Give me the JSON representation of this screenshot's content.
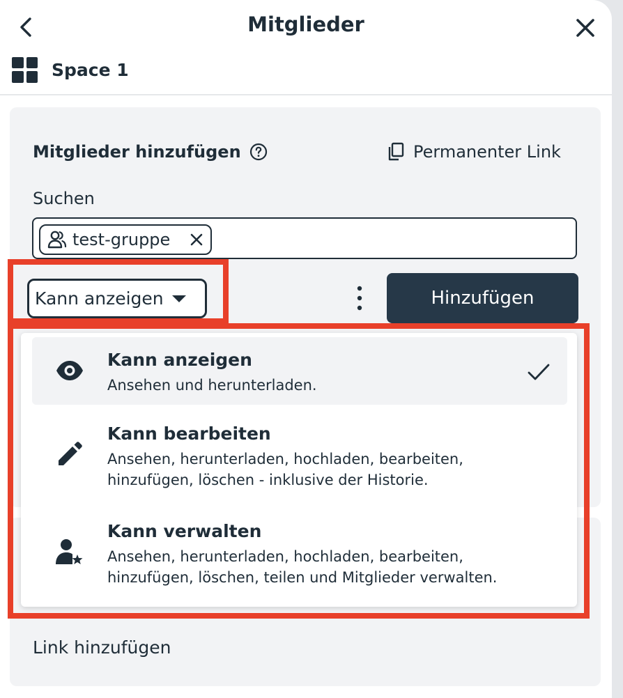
{
  "header": {
    "title": "Mitglieder"
  },
  "space": {
    "name": "Space 1"
  },
  "add_members": {
    "title": "Mitglieder hinzufügen",
    "permanent_link": "Permanenter Link",
    "search_label": "Suchen",
    "chip_label": "test-gruppe",
    "selected_permission": "Kann anzeigen",
    "add_button": "Hinzufügen"
  },
  "permissions_menu": {
    "items": [
      {
        "title": "Kann anzeigen",
        "description": "Ansehen und herunterladen.",
        "icon": "eye-icon",
        "selected": true
      },
      {
        "title": "Kann bearbeiten",
        "description": "Ansehen, herunterladen, hochladen, bearbeiten, hinzufügen, löschen - inklusive der Historie.",
        "icon": "pencil-icon",
        "selected": false
      },
      {
        "title": "Kann verwalten",
        "description": "Ansehen, herunterladen, hochladen, bearbeiten, hinzufügen, löschen, teilen und Mitglieder verwalten.",
        "icon": "admin-user-icon",
        "selected": false
      }
    ]
  },
  "link_section": {
    "label": "Link hinzufügen"
  },
  "colors": {
    "text": "#1f2d38",
    "button_bg": "#263848",
    "card_bg": "#f2f3f5",
    "highlight": "#e8402a"
  }
}
